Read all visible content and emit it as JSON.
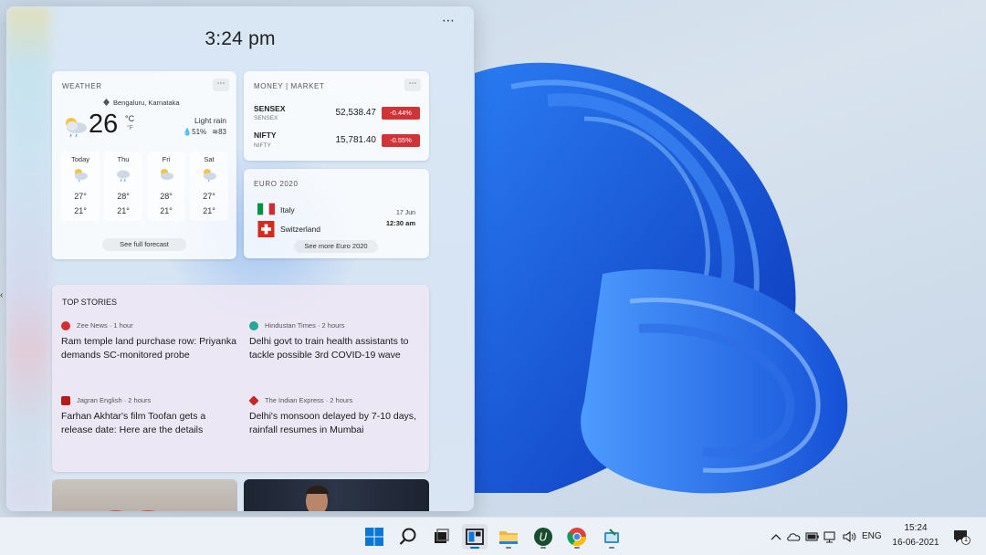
{
  "panel": {
    "time": "3:24 pm",
    "more": "⋯"
  },
  "weather": {
    "title": "WEATHER",
    "more": "⋯",
    "location": "Bengaluru, Karnataka",
    "temperature": "26",
    "unit_c": "°C",
    "unit_f": "°F",
    "condition": "Light rain",
    "humidity": "51%",
    "aqi": "83",
    "forecast": [
      {
        "day": "Today",
        "high": "27°",
        "low": "21°"
      },
      {
        "day": "Thu",
        "high": "28°",
        "low": "21°"
      },
      {
        "day": "Fri",
        "high": "28°",
        "low": "21°"
      },
      {
        "day": "Sat",
        "high": "27°",
        "low": "21°"
      }
    ],
    "link": "See full forecast"
  },
  "money": {
    "title": "MONEY | MARKET",
    "more": "⋯",
    "stocks": [
      {
        "name": "SENSEX",
        "sub": "SENSEX",
        "value": "52,538.47",
        "change": "-0.44%"
      },
      {
        "name": "NIFTY",
        "sub": "NIFTY",
        "value": "15,781.40",
        "change": "-0.55%"
      }
    ]
  },
  "euro": {
    "title": "EURO 2020",
    "team1": "Italy",
    "team2": "Switzerland",
    "date": "17 Jun",
    "time": "12:30 am",
    "link": "See more Euro 2020"
  },
  "stories": {
    "title": "TOP STORIES",
    "items": [
      {
        "source": "Zee News · 1 hour",
        "headline": "Ram temple land purchase row: Priyanka demands SC-monitored probe",
        "color": "#d32f2f"
      },
      {
        "source": "Hindustan Times · 2 hours",
        "headline": "Delhi govt to train health assistants to tackle possible 3rd COVID-19 wave",
        "color": "#26a69a"
      },
      {
        "source": "Jagran English · 2 hours",
        "headline": "Farhan Akhtar's film Toofan gets a release date: Here are the details",
        "color": "#b71c1c"
      },
      {
        "source": "The Indian Express · 2 hours",
        "headline": "Delhi's monsoon delayed by 7-10 days, rainfall resumes in Mumbai",
        "color": "#c62828"
      }
    ]
  },
  "taskbar": {
    "language": "ENG",
    "clock_time": "15:24",
    "clock_date": "16-06-2021",
    "notifications": "1",
    "icons": [
      "windows-start-icon",
      "search-icon",
      "task-view-icon",
      "widgets-icon",
      "file-explorer-icon",
      "upwork-icon",
      "chrome-icon",
      "app-icon"
    ]
  },
  "colors": {
    "accent": "#0067c0",
    "negative": "#d13438",
    "wallpaper_blue": "#1652d8"
  }
}
